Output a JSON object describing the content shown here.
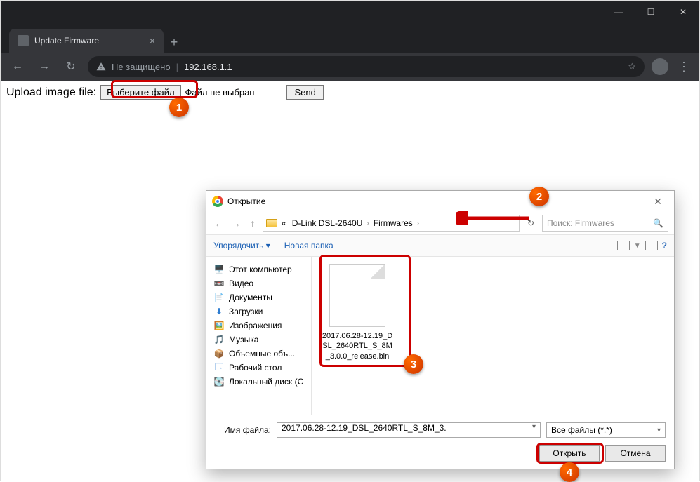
{
  "window": {
    "minimize": "—",
    "maximize": "☐",
    "close": "✕"
  },
  "browser": {
    "tab_title": "Update Firmware",
    "tab_close": "×",
    "new_tab": "+",
    "back": "←",
    "forward": "→",
    "reload": "↻",
    "not_secure": "Не защищено",
    "separator": "|",
    "address": "192.168.1.1",
    "star": "☆",
    "menu": "⋮"
  },
  "page": {
    "upload_label": "Upload image file:",
    "choose_file": "Выберите файл",
    "no_file": "Файл не выбран",
    "send": "Send"
  },
  "dialog": {
    "title": "Открытие",
    "close": "✕",
    "nav_back": "←",
    "nav_fwd": "→",
    "nav_up": "↑",
    "bc_prefix": "«",
    "bc_seg1": "D-Link DSL-2640U",
    "bc_seg2": "Firmwares",
    "bc_arrow": "›",
    "refresh": "↻",
    "search_placeholder": "Поиск: Firmwares",
    "search_icon": "🔍",
    "organize": "Упорядочить ▾",
    "new_folder": "Новая папка",
    "help": "?",
    "tree": {
      "this_pc": "Этот компьютер",
      "videos": "Видео",
      "documents": "Документы",
      "downloads": "Загрузки",
      "pictures": "Изображения",
      "music": "Музыка",
      "objects3d": "Объемные объ...",
      "desktop": "Рабочий стол",
      "localdisk": "Локальный диск (С"
    },
    "file": {
      "name": "2017.06.28-12.19_DSL_2640RTL_S_8M_3.0.0_release.bin"
    },
    "footer": {
      "filename_label": "Имя файла:",
      "filename_value": "2017.06.28-12.19_DSL_2640RTL_S_8M_3.",
      "filter": "Все файлы (*.*)",
      "open": "Открыть",
      "cancel": "Отмена"
    }
  },
  "callouts": {
    "1": "1",
    "2": "2",
    "3": "3",
    "4": "4"
  },
  "icons": {
    "pc": "🖥️",
    "video": "📼",
    "doc": "📄",
    "download": "⬇",
    "picture": "🖼️",
    "music": "🎵",
    "obj3d": "📦",
    "desktop": "🗔",
    "disk": "💽"
  }
}
